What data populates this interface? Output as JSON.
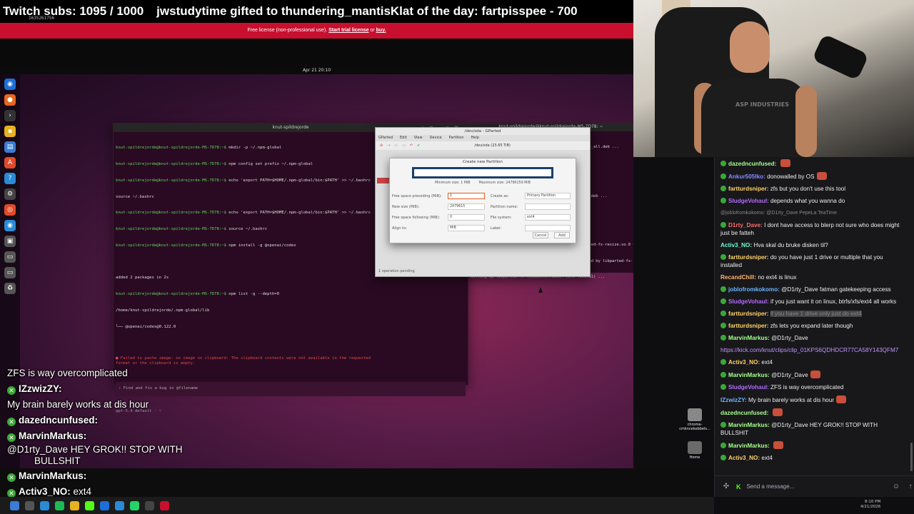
{
  "stream_overlay": {
    "subs": "Twitch subs: 1095 / 1000",
    "gift_message": "jwstudytime gifted to thundering_mantisKlat of the day: fartpisspee - 700"
  },
  "license_bar": {
    "text": "Free license (non-professional use).",
    "trial_link": "Start trial license",
    "or": "or",
    "buy_link": "buy."
  },
  "capture_id": "1635261756",
  "desktop": {
    "date": "Apr 21 20:10",
    "icons": [
      {
        "label": "chrome-cmkncekebbels..."
      },
      {
        "label": "Home"
      }
    ]
  },
  "terminal": {
    "title": "knut-spildrejorde",
    "lines": [
      {
        "prompt": "knut-spildrejorde@knut-spildrejorde-MS-7D78:~$",
        "cmd": " mkdir -p ~/.npm-global"
      },
      {
        "prompt": "knut-spildrejorde@knut-spildrejorde-MS-7D78:~$",
        "cmd": " npm config set prefix ~/.npm-global"
      },
      {
        "prompt": "knut-spildrejorde@knut-spildrejorde-MS-7D78:~$",
        "cmd": " echo 'export PATH=$HOME/.npm-global/bin:$PATH' >> ~/.bashrc"
      },
      {
        "prompt": "",
        "cmd": "source ~/.bashrc"
      },
      {
        "prompt": "knut-spildrejorde@knut-spildrejorde-MS-7D78:~$",
        "cmd": " echo 'export PATH=$HOME/.npm-global/bin:$PATH' >> ~/.bashrc"
      },
      {
        "prompt": "knut-spildrejorde@knut-spildrejorde-MS-7D78:~$",
        "cmd": " source ~/.bashrc"
      },
      {
        "prompt": "knut-spildrejorde@knut-spildrejorde-MS-7D78:~$",
        "cmd": " npm install -g @openai/codex"
      },
      {
        "prompt": "",
        "cmd": ""
      },
      {
        "prompt": "",
        "cmd": "added 2 packages in 2s"
      },
      {
        "prompt": "knut-spildrejorde@knut-spildrejorde-MS-7D78:~$",
        "cmd": " npm list -g --depth=0"
      },
      {
        "prompt": "",
        "cmd": "/home/knut-spildrejorde/.npm-global/lib"
      },
      {
        "prompt": "",
        "cmd": "└── @openai/codex@0.122.0"
      }
    ],
    "error": "■ Failed to paste image: no image on clipboard: The clipboard contents were not available in the requested format or the clipboard is empty.",
    "input_placeholder": "› Find and fix a bug in @filename",
    "model": "gpt-5.4 default · ~"
  },
  "terminal2": {
    "title": "knut-spildrejorde@knut-spildrejorde-MS-7D78: ~",
    "lines": [
      "Preparing to unpack .../gparted-common_1.5.0-1build4_all.deb ...",
      "Unpacking gparted-common (1.5.0-1build4) ...",
      "Selecting previously unselected package gparted.",
      "Preparing to unpack .../gparted_1.5.0-1build4_amd64.deb ...",
      "Unpacking gparted (1.5.0-1build4) ...",
      "Setting up gparted-common (1.5.0-1build4) ...",
      "Removing 'diversion of /lib/x86_64-linux-gnu/libparted-fs-resize.so.0 to /lib/x8",
      "6_64-linux-gnu/libparted-fs-resize.so.0.usr-is-merged by libparted-fs-resize0t64",
      "Setting up libparted-fs-resize0t64:amd64 (3.6-4build1) ..."
    ]
  },
  "gparted": {
    "title": "/dev/sda - GParted",
    "menu": [
      "GParted",
      "Edit",
      "View",
      "Device",
      "Partition",
      "Help"
    ],
    "device": "/dev/sda",
    "device_size": "(23.65 TiB)",
    "status": "1 operation pending"
  },
  "dialog": {
    "title": "Create new Partition",
    "min_size": "Minimum size: 1 MiB",
    "max_size": "Maximum size: 24796159 MiB",
    "free_preceding_label": "Free space preceding (MiB):",
    "free_preceding_value": "1",
    "new_size_label": "New size (MiB):",
    "new_size_value": "2479615",
    "free_following_label": "Free space following (MiB):",
    "free_following_value": "0",
    "align_label": "Align to:",
    "align_value": "MiB",
    "create_as_label": "Create as:",
    "create_as_value": "Primary Partition",
    "partition_name_label": "Partition name:",
    "filesystem_label": "File system:",
    "filesystem_value": "ext4",
    "label_label": "Label:",
    "cancel": "Cancel",
    "add": "Add"
  },
  "overlay_chat": [
    {
      "user": "",
      "text": "ZFS is way overcomplicated"
    },
    {
      "user": "IZzwizZY:",
      "text": ""
    },
    {
      "user": "",
      "text": "My brain barely works at dis hour"
    },
    {
      "user": "dazedncunfused:",
      "text": ""
    },
    {
      "user": "MarvinMarkus:",
      "text": ""
    },
    {
      "user": "",
      "text": "@D1rty_Dave HEY GROK!! STOP WITH"
    },
    {
      "user": "",
      "text": "BULLSHIT"
    },
    {
      "user": "MarvinMarkus:",
      "text": ""
    },
    {
      "user": "Activ3_NO:",
      "text": "ext4"
    }
  ],
  "chat": {
    "messages": [
      {
        "user": "dazedncunfused:",
        "text": ""
      },
      {
        "user": "Ankur505lko:",
        "text": "donowalled by OS"
      },
      {
        "user": "fartturdsniper:",
        "text": "zfs but you don't use this tool"
      },
      {
        "user": "SludgeVohaul:",
        "text": "depends what you wanna do"
      },
      {
        "user": "",
        "text": "@joblofromkokomo: @D1rty_Dave PepeLa TeaTime"
      },
      {
        "user": "D1rty_Dave:",
        "text": "I dont have access to blerp not sure who does might just be fatteh"
      },
      {
        "user": "Activ3_NO:",
        "text": "Hva skal du bruke disken til?"
      },
      {
        "user": "fartturdsniper:",
        "text": "do you have just 1 drive or multiple that you installed"
      },
      {
        "user": "RecandChill:",
        "text": "no ext4 is linux"
      },
      {
        "user": "joblofromkokomo:",
        "text": "@D1rty_Dave fatman gatekeeping access"
      },
      {
        "user": "SludgeVohaul:",
        "text": "if you just want it on linux, btrfs/xfs/ext4 all works"
      },
      {
        "user": "fartturdsniper:",
        "text": "if you have 1 drive only just do ext4"
      },
      {
        "user": "fartturdsniper:",
        "text": "zfs lets you expand later though"
      },
      {
        "user": "MarvinMarkus:",
        "text": "@D1rty_Dave"
      },
      {
        "user": "",
        "text": "https://kick.com/knut/clips/clip_01KPS6QDHDCR77CA58Y143QFM7"
      },
      {
        "user": "Activ3_NO:",
        "text": "ext4"
      },
      {
        "user": "MarvinMarkus:",
        "text": "@D1rty_Dave"
      },
      {
        "user": "SludgeVohaul:",
        "text": "ZFS is way overcomplicated"
      },
      {
        "user": "IZzwizZY:",
        "text": "My brain barely works at dis hour"
      },
      {
        "user": "dazedncunfused:",
        "text": ""
      },
      {
        "user": "MarvinMarkus:",
        "text": "@D1rty_Dave HEY GROK!! STOP WITH BULLSHIT"
      },
      {
        "user": "MarvinMarkus:",
        "text": ""
      },
      {
        "user": "Activ3_NO:",
        "text": "ext4"
      }
    ],
    "input_placeholder": "Send a message..."
  },
  "clock": {
    "time": "8:10 PM",
    "date": "4/21/2026"
  },
  "webcam": {
    "shirt_text": "ASP INDUSTRIES"
  },
  "colors": {
    "license_red": "#c8102e",
    "kick_green": "#53fc18",
    "badge_green": "#3aa836",
    "chat_bg": "#18181b",
    "link_purple": "#bf94ff"
  }
}
